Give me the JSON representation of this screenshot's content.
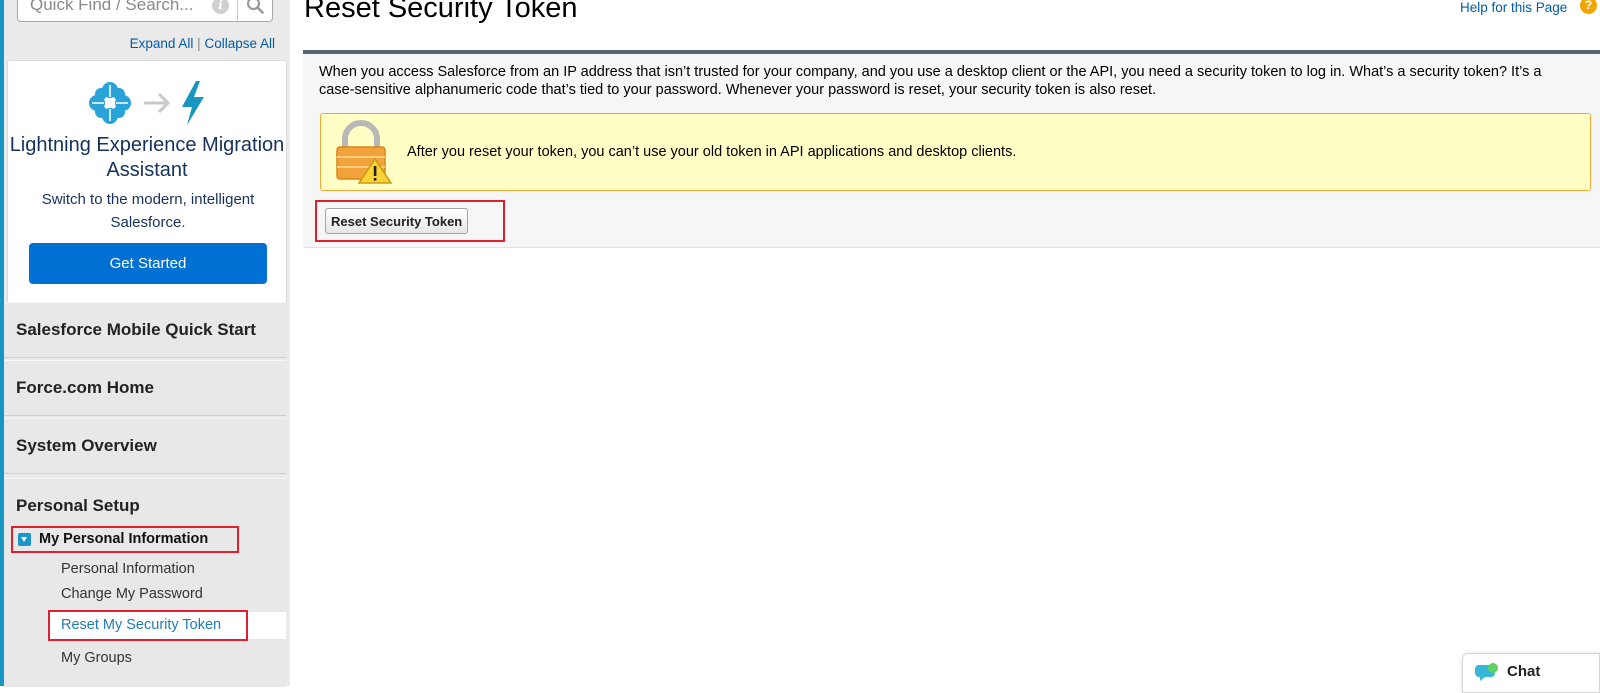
{
  "sidebar": {
    "search": {
      "placeholder": "Quick Find / Search..."
    },
    "expand_all": "Expand All",
    "separator": "|",
    "collapse_all": "Collapse All",
    "promo": {
      "title": "Lightning Experience Migration Assistant",
      "subtitle": "Switch to the modern, intelligent Salesforce.",
      "button": "Get Started"
    },
    "sections": [
      "Salesforce Mobile Quick Start",
      "Force.com Home",
      "System Overview"
    ],
    "personal_setup": {
      "title": "Personal Setup",
      "group_label": "My Personal Information",
      "items": [
        "Personal Information",
        "Change My Password",
        "Reset My Security Token",
        "My Groups"
      ]
    }
  },
  "header": {
    "title": "Reset Security Token",
    "help_link": "Help for this Page",
    "help_icon_glyph": "?"
  },
  "content": {
    "description": "When you access Salesforce from an IP address that isn’t trusted for your company, and you use a desktop client or the API, you need a security token to log in. What’s a security token? It’s a case-sensitive alphanumeric code that’s tied to your password. Whenever your password is reset, your security token is also reset.",
    "warning": "After you reset your token, you can’t use your old token in API applications and desktop clients.",
    "reset_button": "Reset Security Token"
  },
  "chat": {
    "label": "Chat"
  },
  "colors": {
    "accent": "#1797c0",
    "link": "#015ba7",
    "primary_button": "#0070d2",
    "highlight_border": "#e0202f",
    "warning_bg": "#ffffc5",
    "warning_border": "#f0a73a"
  },
  "icons": {
    "search": "search-icon",
    "info": "info-icon",
    "help": "help-icon",
    "lock_warning": "lock-warning-icon",
    "chat": "chat-bubble-icon"
  }
}
